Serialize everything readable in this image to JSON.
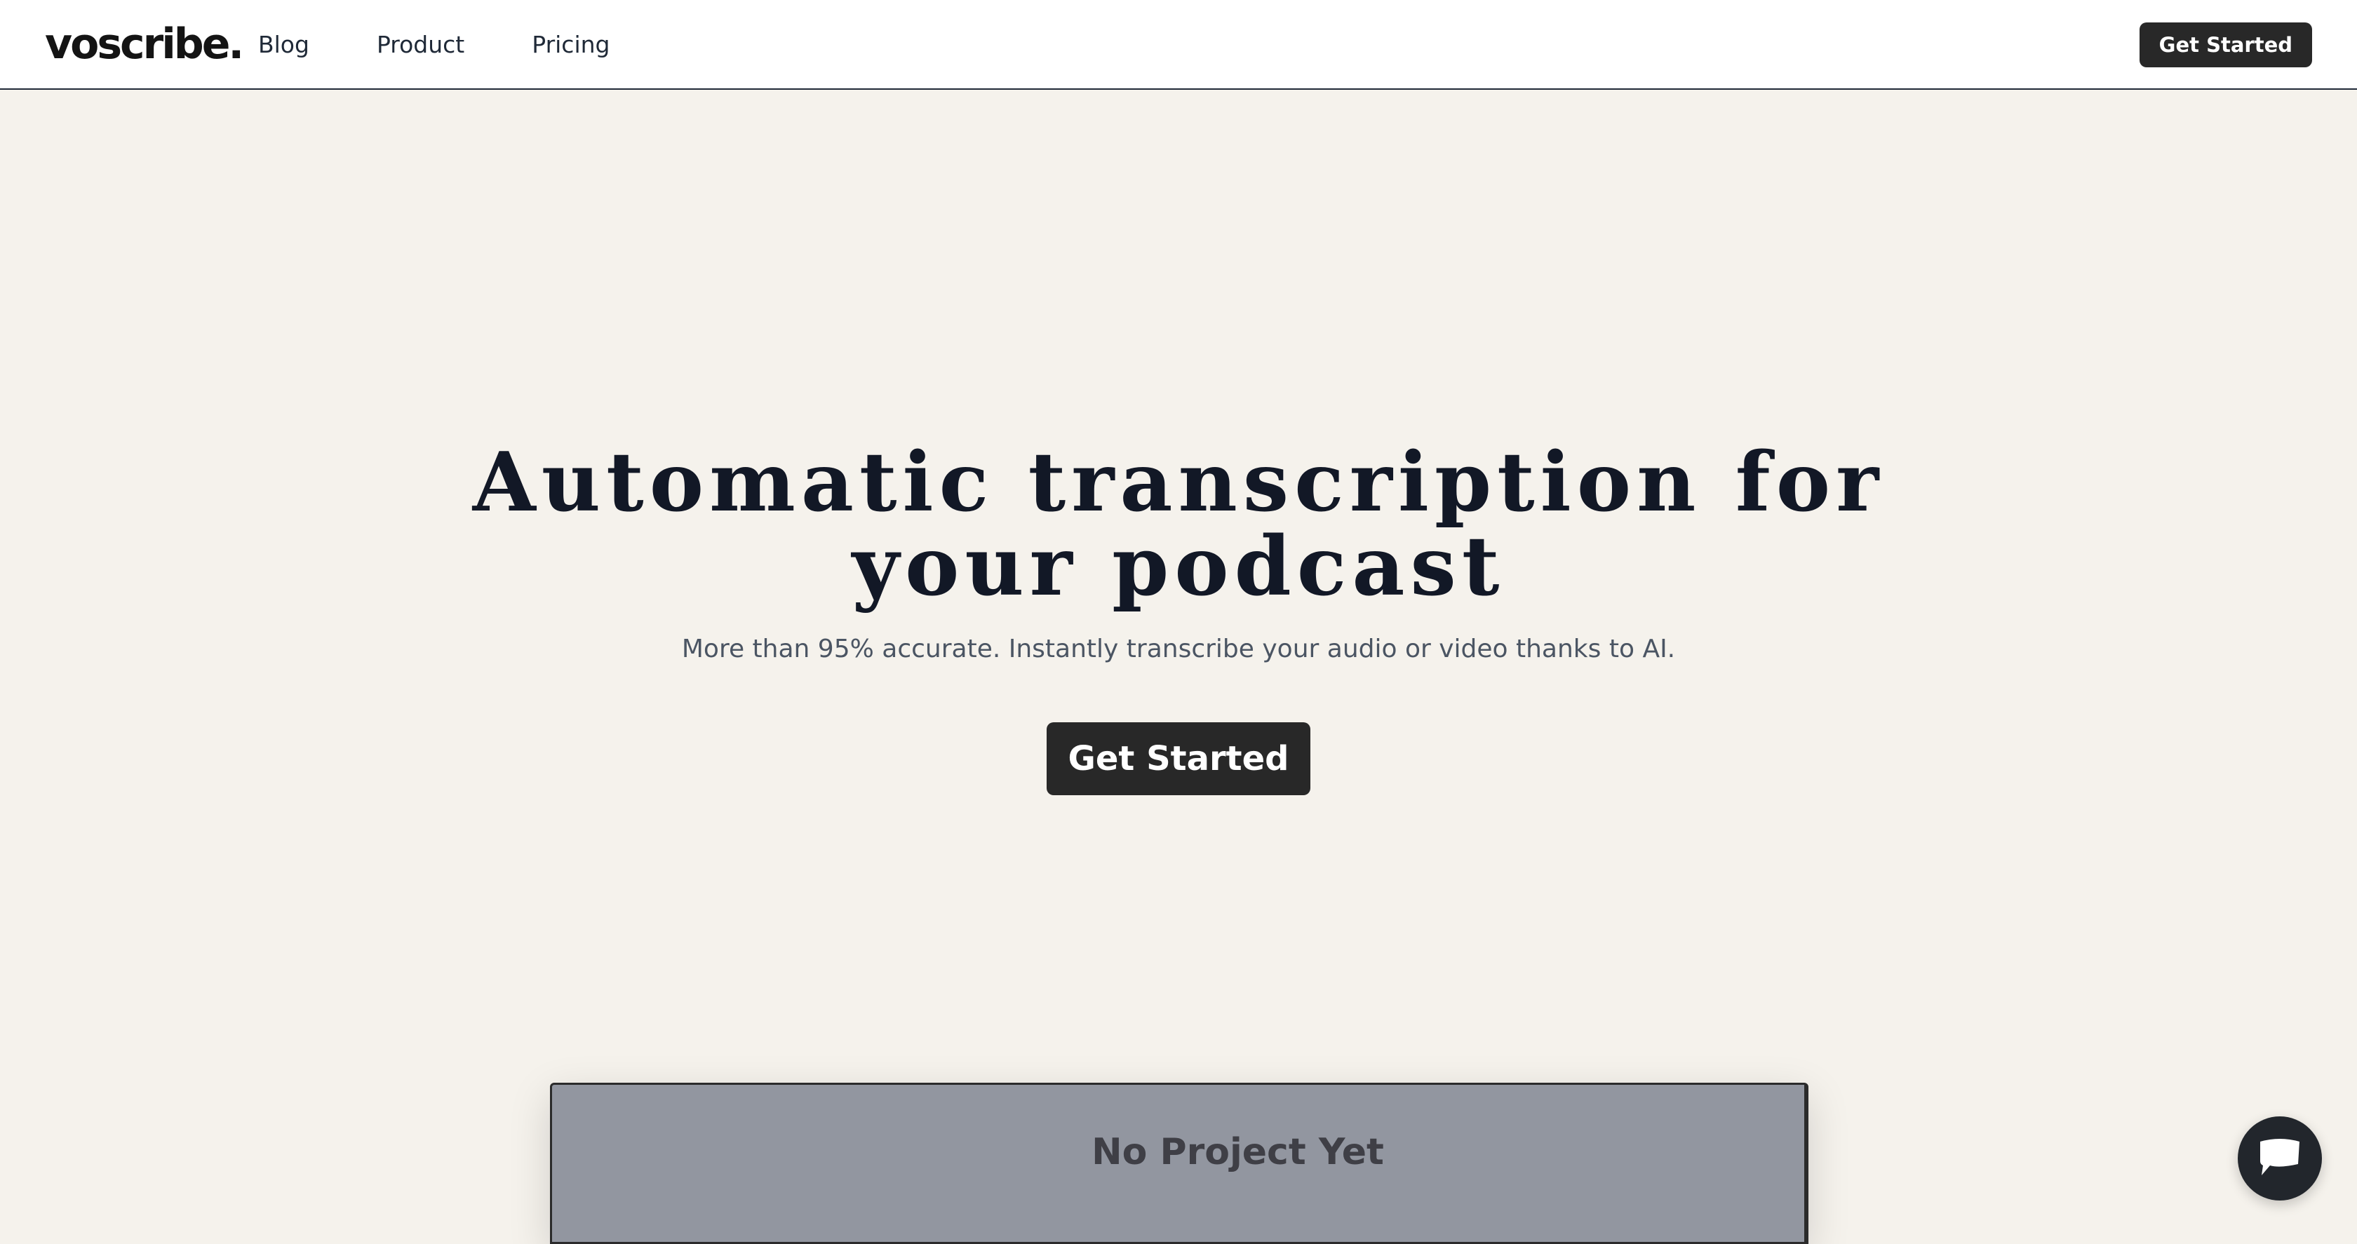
{
  "brand": {
    "logo_text": "voscribe."
  },
  "nav": {
    "items": [
      {
        "label": "Blog"
      },
      {
        "label": "Product"
      },
      {
        "label": "Pricing"
      }
    ],
    "cta_label": "Get Started"
  },
  "hero": {
    "title": "Automatic transcription for your podcast",
    "subtitle": "More than 95% accurate. Instantly transcribe your audio or video thanks to AI.",
    "cta_label": "Get Started"
  },
  "preview": {
    "empty_state_title": "No Project Yet"
  },
  "chat": {
    "icon": "chat-bubble-icon"
  },
  "colors": {
    "background": "#f5f2ec",
    "primary_button": "#282828",
    "heading_text": "#121826",
    "body_text": "#4b5563",
    "preview_panel": "#9296a0"
  }
}
